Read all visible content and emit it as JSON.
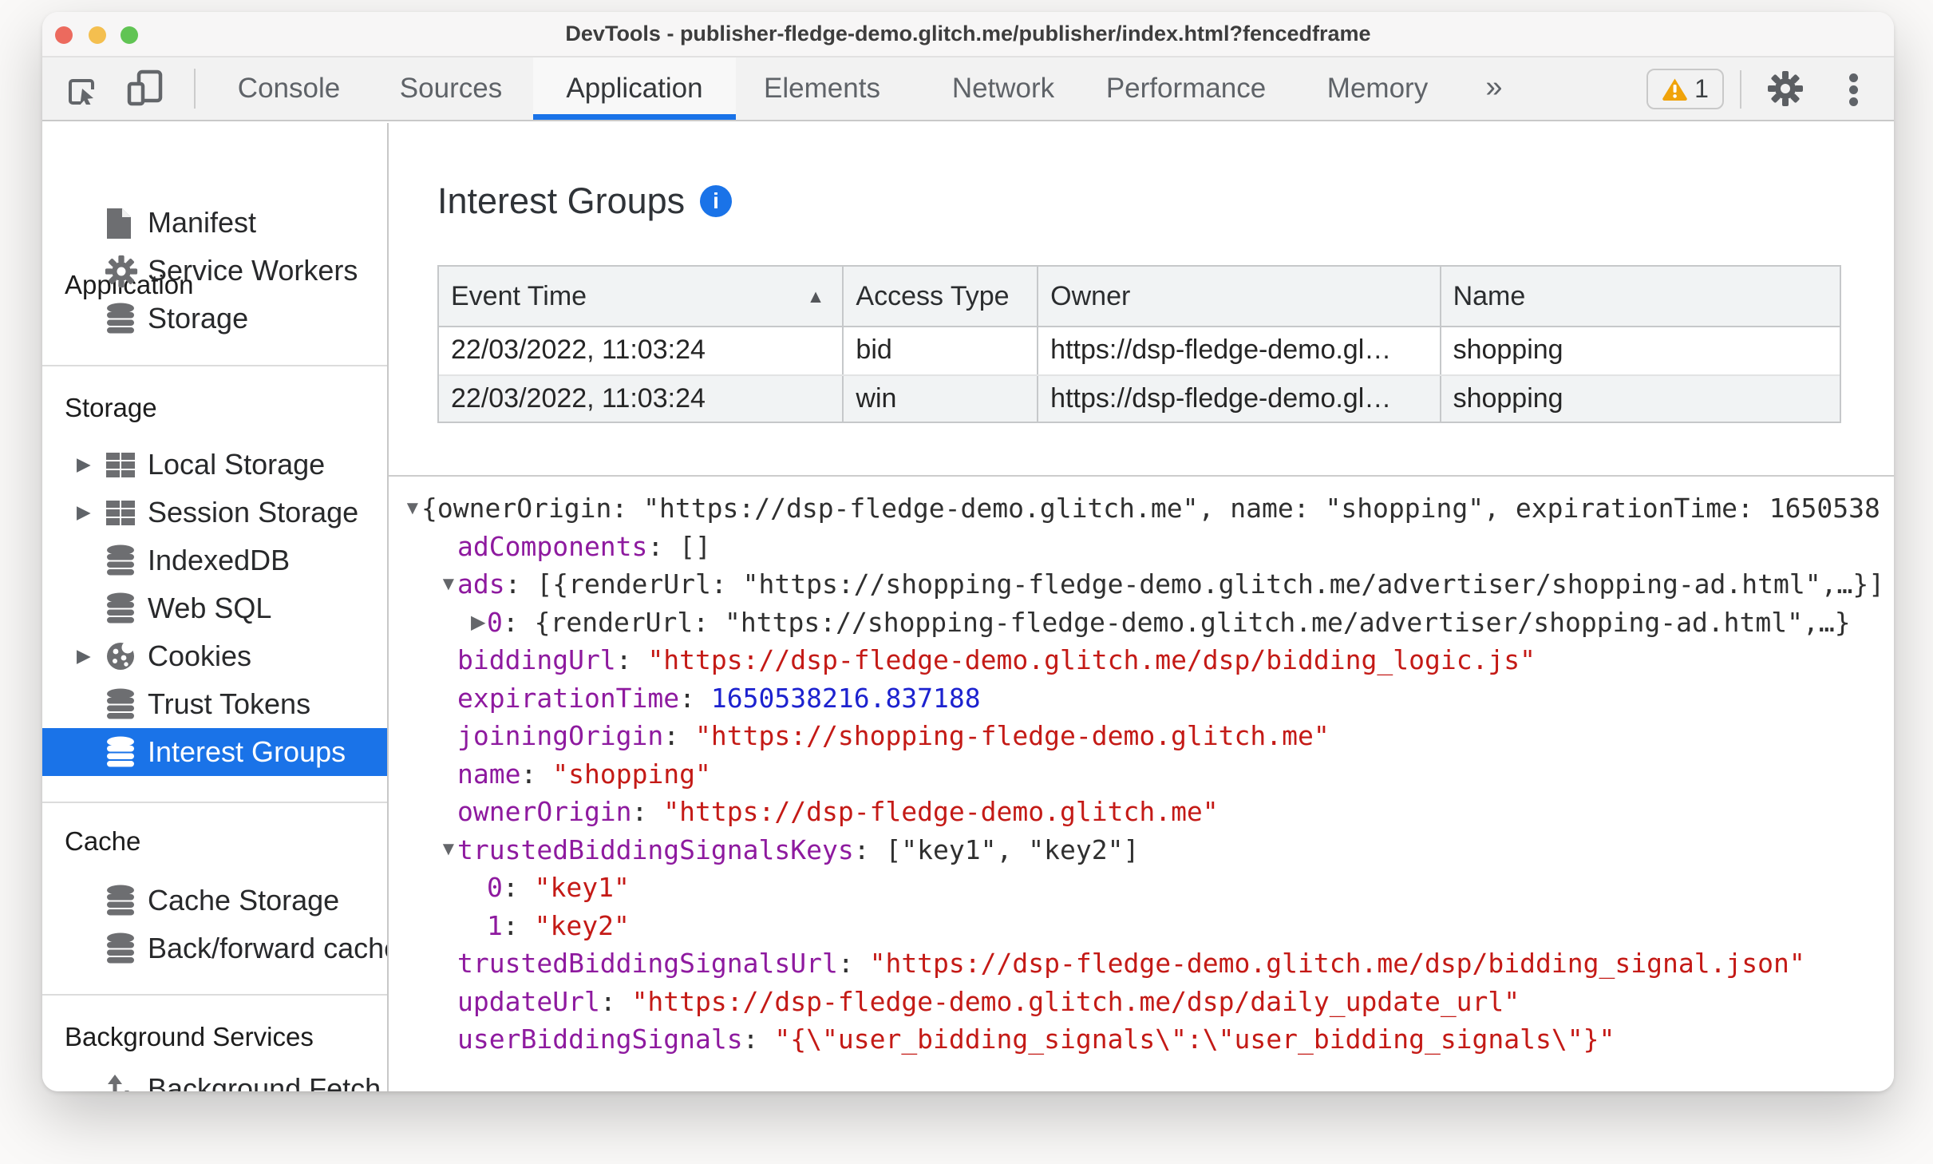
{
  "window": {
    "title": "DevTools - publisher-fledge-demo.glitch.me/publisher/index.html?fencedframe"
  },
  "toolbar": {
    "tabs": [
      {
        "label": "Console"
      },
      {
        "label": "Sources"
      },
      {
        "label": "Application"
      },
      {
        "label": "Elements"
      },
      {
        "label": "Network"
      },
      {
        "label": "Performance"
      },
      {
        "label": "Memory"
      }
    ],
    "overflow_chevron": "»",
    "warning_count": "1"
  },
  "sidebar": {
    "sections": [
      {
        "title": "Application",
        "items": [
          {
            "label": "Manifest"
          },
          {
            "label": "Service Workers"
          },
          {
            "label": "Storage"
          }
        ]
      },
      {
        "title": "Storage",
        "items": [
          {
            "label": "Local Storage"
          },
          {
            "label": "Session Storage"
          },
          {
            "label": "IndexedDB"
          },
          {
            "label": "Web SQL"
          },
          {
            "label": "Cookies"
          },
          {
            "label": "Trust Tokens"
          },
          {
            "label": "Interest Groups"
          }
        ]
      },
      {
        "title": "Cache",
        "items": [
          {
            "label": "Cache Storage"
          },
          {
            "label": "Back/forward cache"
          }
        ]
      },
      {
        "title": "Background Services",
        "items": [
          {
            "label": "Background Fetch"
          }
        ]
      }
    ]
  },
  "main": {
    "heading": "Interest Groups",
    "table": {
      "columns": [
        "Event Time",
        "Access Type",
        "Owner",
        "Name"
      ],
      "rows": [
        {
          "event_time": "22/03/2022, 11:03:24",
          "access_type": "bid",
          "owner": "https://dsp-fledge-demo.gl…",
          "name": "shopping"
        },
        {
          "event_time": "22/03/2022, 11:03:24",
          "access_type": "win",
          "owner": "https://dsp-fledge-demo.gl…",
          "name": "shopping"
        }
      ]
    },
    "tree": {
      "rows": [
        {
          "text": "{ownerOrigin: \"https://dsp-fledge-demo.glitch.me\", name: \"shopping\", expirationTime: 1650538"
        },
        {
          "key": "adComponents",
          "rest": ": []"
        },
        {
          "key": "ads",
          "rest": ": [{renderUrl: \"https://shopping-fledge-demo.glitch.me/advertiser/shopping-ad.html\",…}]"
        },
        {
          "key": "0",
          "rest": ": {renderUrl: \"https://shopping-fledge-demo.glitch.me/advertiser/shopping-ad.html\",…}"
        },
        {
          "key": "biddingUrl",
          "sep": ": ",
          "value": "\"https://dsp-fledge-demo.glitch.me/dsp/bidding_logic.js\""
        },
        {
          "key": "expirationTime",
          "sep": ": ",
          "value": "1650538216.837188"
        },
        {
          "key": "joiningOrigin",
          "sep": ": ",
          "value": "\"https://shopping-fledge-demo.glitch.me\""
        },
        {
          "key": "name",
          "sep": ": ",
          "value": "\"shopping\""
        },
        {
          "key": "ownerOrigin",
          "sep": ": ",
          "value": "\"https://dsp-fledge-demo.glitch.me\""
        },
        {
          "key": "trustedBiddingSignalsKeys",
          "rest": ": [\"key1\", \"key2\"]"
        },
        {
          "key": "0",
          "sep": ": ",
          "value": "\"key1\""
        },
        {
          "key": "1",
          "sep": ": ",
          "value": "\"key2\""
        },
        {
          "key": "trustedBiddingSignalsUrl",
          "sep": ": ",
          "value": "\"https://dsp-fledge-demo.glitch.me/dsp/bidding_signal.json\""
        },
        {
          "key": "updateUrl",
          "sep": ": ",
          "value": "\"https://dsp-fledge-demo.glitch.me/dsp/daily_update_url\""
        },
        {
          "key": "userBiddingSignals",
          "sep": ": ",
          "value": "\"{\\\"user_bidding_signals\\\":\\\"user_bidding_signals\\\"}\""
        }
      ]
    }
  }
}
